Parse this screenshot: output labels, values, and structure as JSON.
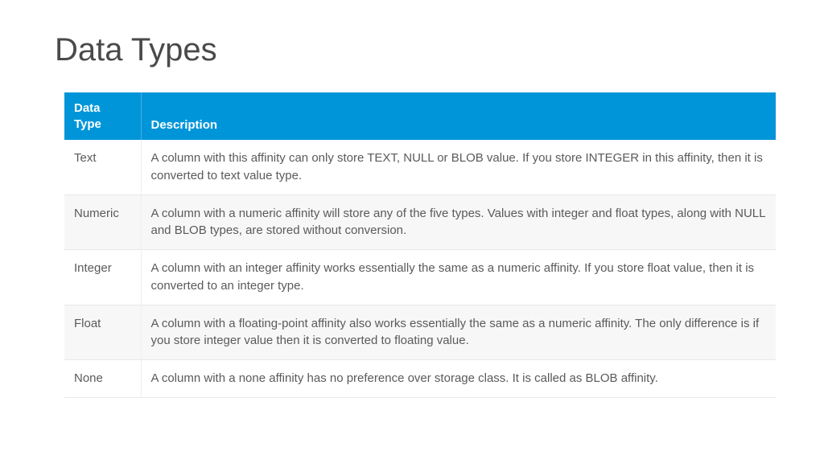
{
  "title": "Data Types",
  "table": {
    "headers": {
      "type": "Data Type",
      "description": "Description"
    },
    "rows": [
      {
        "type": "Text",
        "description": "A column with this affinity can only store TEXT, NULL or BLOB value. If you store INTEGER in this affinity, then it is converted to text value type."
      },
      {
        "type": "Numeric",
        "description": "A column with a numeric affinity will store any of the five types. Values with integer and float types, along with NULL and BLOB types, are stored without conversion."
      },
      {
        "type": "Integer",
        "description": "A column with an integer affinity works essentially the same as a numeric affinity. If you store float value, then it is converted to an integer type."
      },
      {
        "type": "Float",
        "description": "A column with a floating-point affinity also works essentially the same as a numeric affinity. The only difference is if you store integer value then it is converted to floating value."
      },
      {
        "type": "None",
        "description": "A column with a none affinity has no preference over storage class. It is called as BLOB affinity."
      }
    ]
  }
}
